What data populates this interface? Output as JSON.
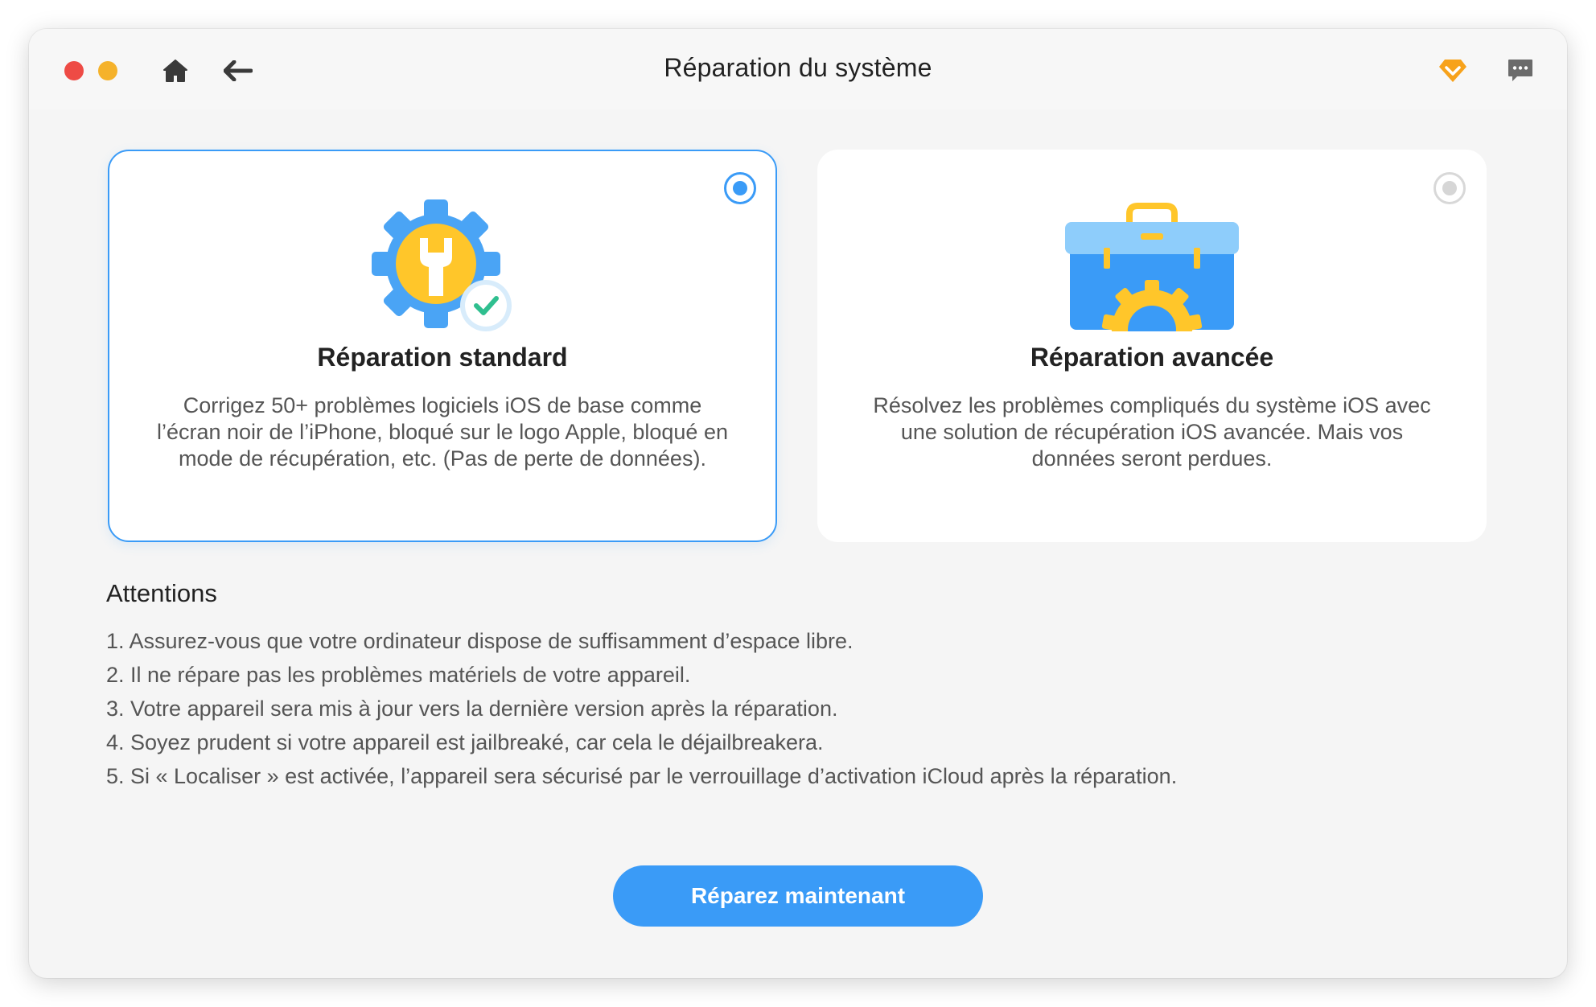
{
  "window": {
    "title": "Réparation du système"
  },
  "toolbar": {
    "home_icon": "home-icon",
    "back_icon": "arrow-left-icon",
    "premium_icon": "diamond-icon",
    "feedback_icon": "chat-bubble-icon"
  },
  "modes": [
    {
      "title": "Réparation standard",
      "description": "Corrigez 50+ problèmes logiciels iOS de base comme l’écran noir de l’iPhone, bloqué sur le logo Apple, bloqué en mode de récupération, etc. (Pas de perte de données).",
      "selected": true,
      "icon": "gear-wrench-check-icon"
    },
    {
      "title": "Réparation avancée",
      "description": "Résolvez les problèmes compliqués du système iOS avec une solution de récupération iOS avancée. Mais vos données seront perdues.",
      "selected": false,
      "icon": "toolbox-gear-icon"
    }
  ],
  "attentions": {
    "title": "Attentions",
    "items": [
      "1. Assurez-vous que votre ordinateur dispose de suffisamment d’espace libre.",
      "2. Il ne répare pas les problèmes matériels de votre appareil.",
      "3. Votre appareil sera mis à jour vers la dernière version après la réparation.",
      "4. Soyez prudent si votre appareil est jailbreaké, car cela le déjailbreakera.",
      "5. Si « Localiser » est activée, l’appareil sera sécurisé par le verrouillage d’activation iCloud après la réparation."
    ]
  },
  "actions": {
    "repair_now": "Réparez maintenant"
  },
  "colors": {
    "accent": "#3a9bf7",
    "close": "#ee4b45",
    "minimize": "#f5b22b",
    "premium": "#f7a21b"
  }
}
